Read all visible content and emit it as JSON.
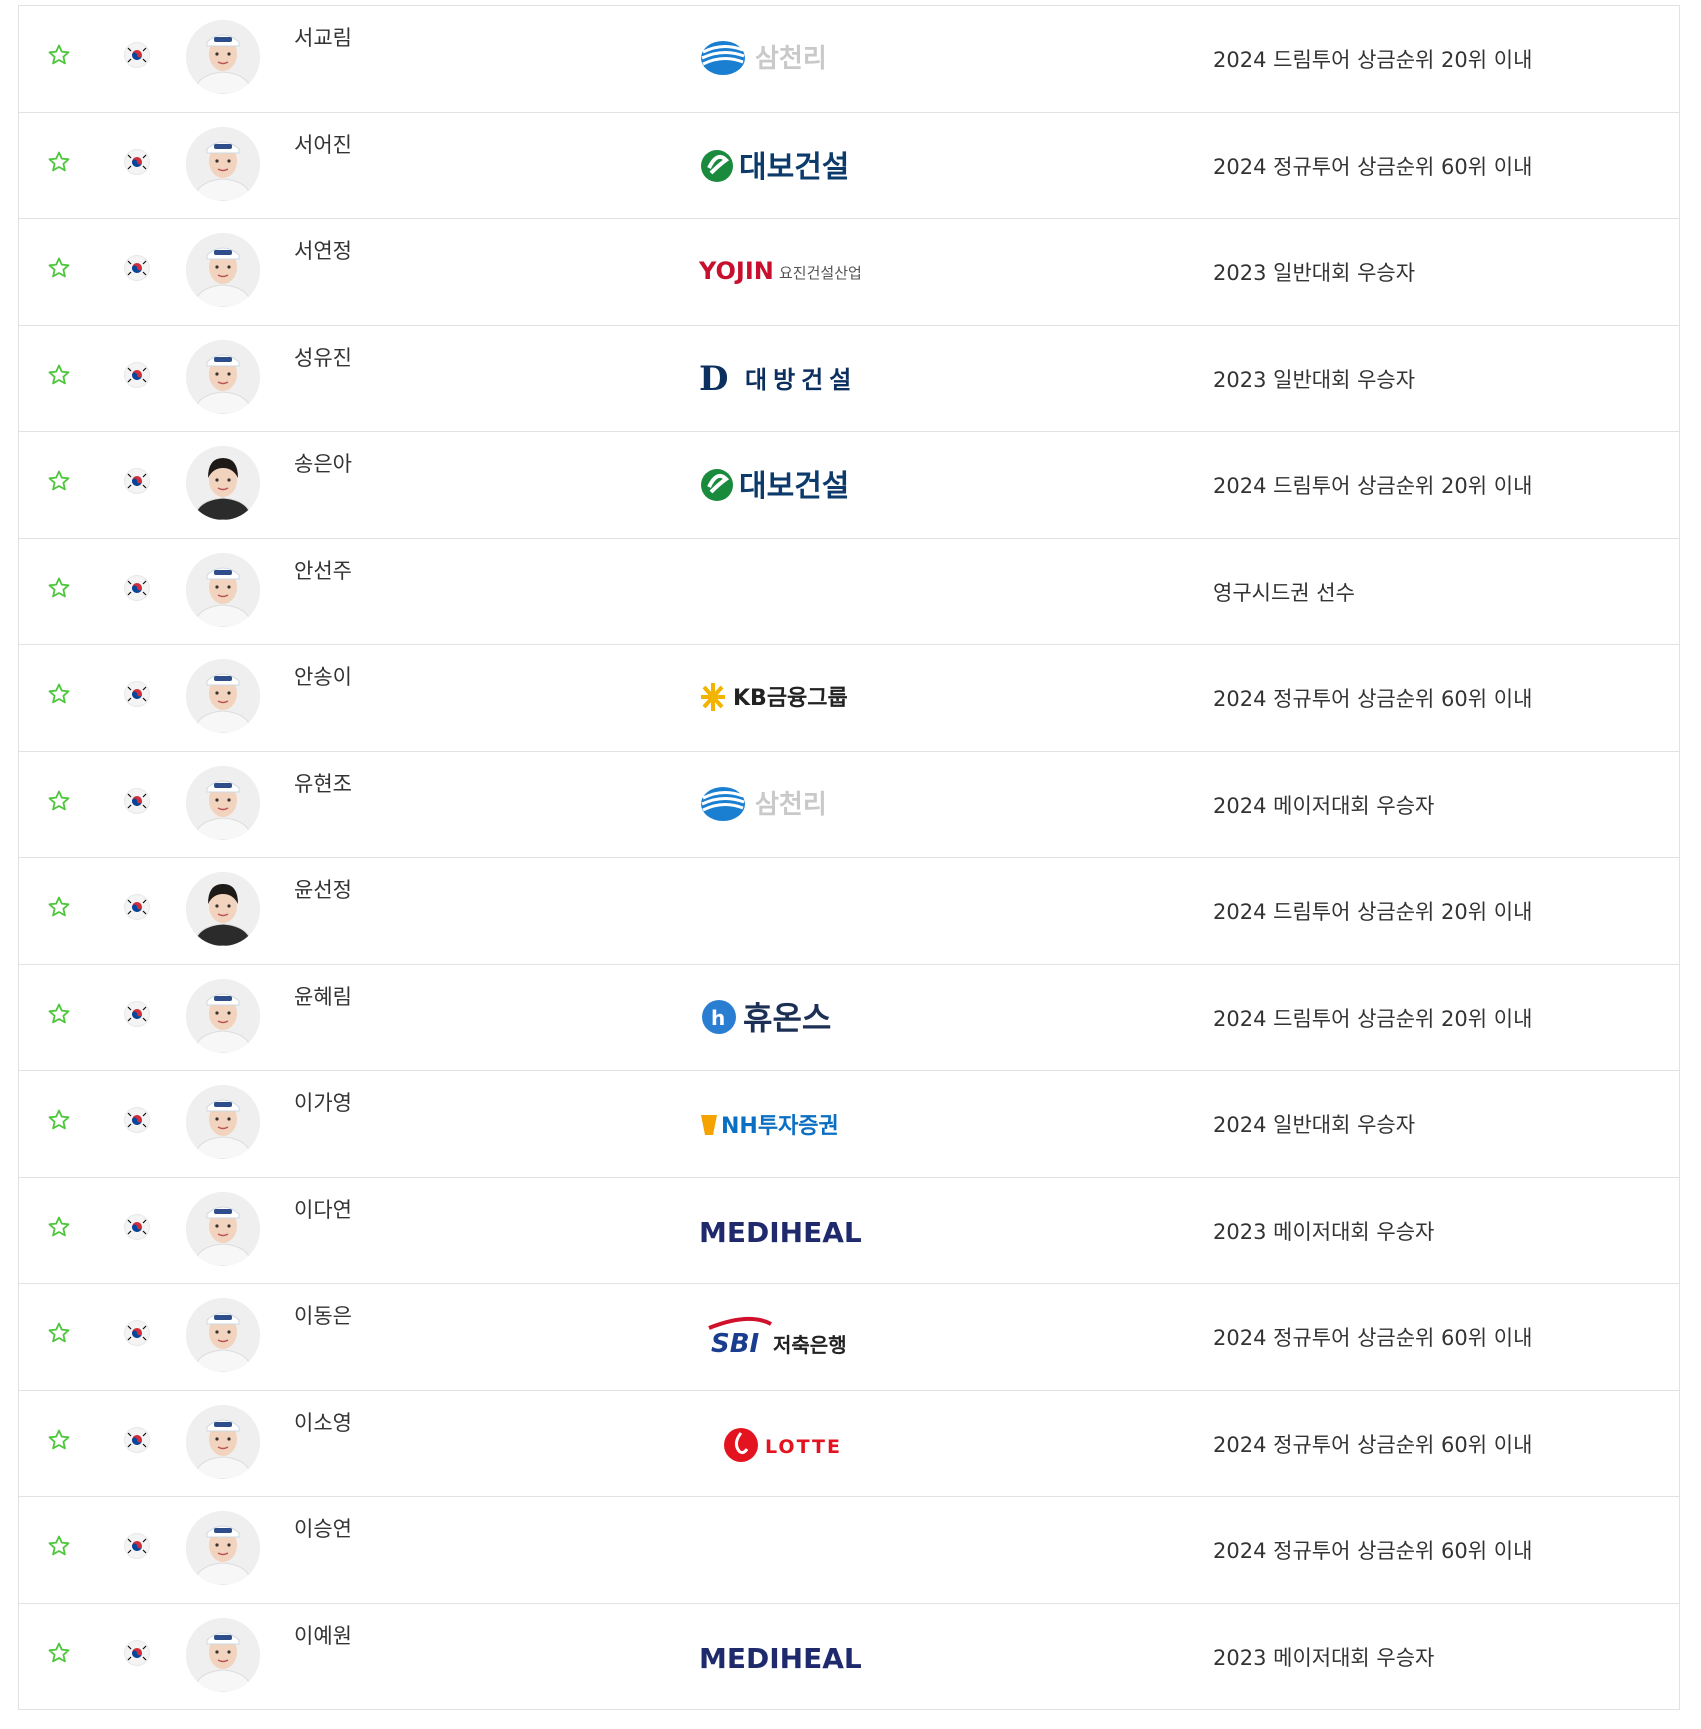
{
  "players": [
    {
      "name": "서교림",
      "sponsor": "삼천리",
      "sponsor_logo": "samchully",
      "seed": "2024 드림투어 상금순위 20위 이내",
      "avatar_icon": "player-photo",
      "hair": "cap-white"
    },
    {
      "name": "서어진",
      "sponsor": "대보건설",
      "sponsor_logo": "daebo",
      "seed": "2024 정규투어 상금순위 60위 이내",
      "avatar_icon": "player-photo",
      "hair": "cap-white"
    },
    {
      "name": "서연정",
      "sponsor": "YOJIN 요진건설산업",
      "sponsor_logo": "yojin",
      "seed": "2023 일반대회 우승자",
      "avatar_icon": "player-photo",
      "hair": "cap-white"
    },
    {
      "name": "성유진",
      "sponsor": "대방건설",
      "sponsor_logo": "daebang",
      "seed": "2023 일반대회 우승자",
      "avatar_icon": "player-photo",
      "hair": "cap-white"
    },
    {
      "name": "송은아",
      "sponsor": "대보건설",
      "sponsor_logo": "daebo",
      "seed": "2024 드림투어 상금순위 20위 이내",
      "avatar_icon": "player-photo",
      "hair": "dark"
    },
    {
      "name": "안선주",
      "sponsor": "",
      "sponsor_logo": "none",
      "seed": "영구시드권 선수",
      "avatar_icon": "player-photo",
      "hair": "cap-white"
    },
    {
      "name": "안송이",
      "sponsor": "KB금융그룹",
      "sponsor_logo": "kb",
      "seed": "2024 정규투어 상금순위 60위 이내",
      "avatar_icon": "player-photo",
      "hair": "cap-white"
    },
    {
      "name": "유현조",
      "sponsor": "삼천리",
      "sponsor_logo": "samchully",
      "seed": "2024 메이저대회 우승자",
      "avatar_icon": "player-photo",
      "hair": "cap-white"
    },
    {
      "name": "윤선정",
      "sponsor": "",
      "sponsor_logo": "none",
      "seed": "2024 드림투어 상금순위 20위 이내",
      "avatar_icon": "player-photo",
      "hair": "dark"
    },
    {
      "name": "윤혜림",
      "sponsor": "휴온스",
      "sponsor_logo": "huons",
      "seed": "2024 드림투어 상금순위 20위 이내",
      "avatar_icon": "player-photo",
      "hair": "cap-white"
    },
    {
      "name": "이가영",
      "sponsor": "NH투자증권",
      "sponsor_logo": "nh",
      "seed": "2024 일반대회 우승자",
      "avatar_icon": "player-photo",
      "hair": "cap-white"
    },
    {
      "name": "이다연",
      "sponsor": "MEDIHEAL",
      "sponsor_logo": "mediheal",
      "seed": "2023 메이저대회 우승자",
      "avatar_icon": "player-photo",
      "hair": "cap-white"
    },
    {
      "name": "이동은",
      "sponsor": "SBI 저축은행",
      "sponsor_logo": "sbi",
      "seed": "2024 정규투어 상금순위 60위 이내",
      "avatar_icon": "player-photo",
      "hair": "cap-white"
    },
    {
      "name": "이소영",
      "sponsor": "LOTTE",
      "sponsor_logo": "lotte",
      "seed": "2024 정규투어 상금순위 60위 이내",
      "avatar_icon": "player-photo",
      "hair": "cap-white"
    },
    {
      "name": "이승연",
      "sponsor": "",
      "sponsor_logo": "none",
      "seed": "2024 정규투어 상금순위 60위 이내",
      "avatar_icon": "player-photo",
      "hair": "cap-white"
    },
    {
      "name": "이예원",
      "sponsor": "MEDIHEAL",
      "sponsor_logo": "mediheal",
      "seed": "2023 메이저대회 우승자",
      "avatar_icon": "player-photo",
      "hair": "cap-white"
    }
  ],
  "icons": {
    "favorite": "star-outline-icon",
    "flag": "korea-flag-icon"
  },
  "colors": {
    "star": "#4cc63a",
    "border": "#e2e2e2",
    "text": "#333333"
  }
}
